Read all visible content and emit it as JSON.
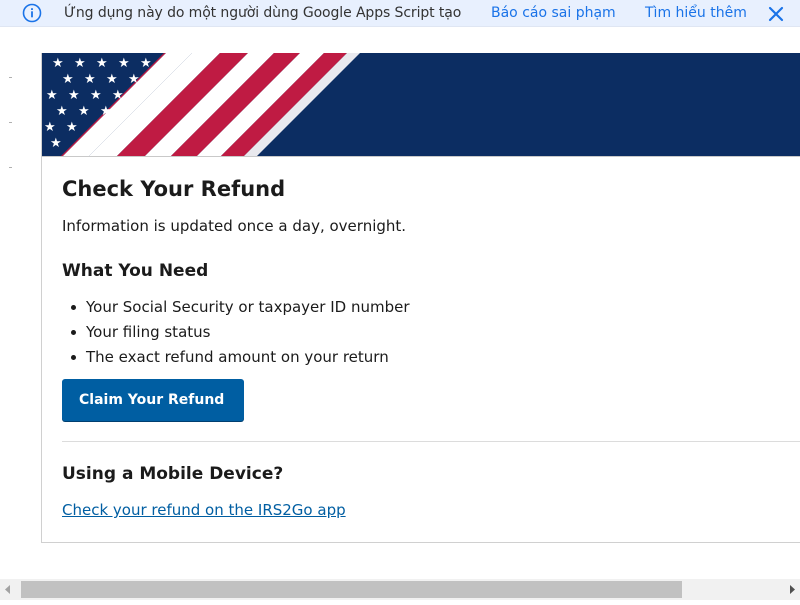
{
  "banner": {
    "icon": "info-icon",
    "message": "Ứng dụng này do một người dùng Google Apps Script tạo",
    "report_label": "Báo cáo sai phạm",
    "learn_more_label": "Tìm hiểu thêm",
    "close_icon": "close-icon",
    "background": "#e8f0fe",
    "link_color": "#1a73e8"
  },
  "card": {
    "title": "Check Your Refund",
    "subtitle": "Information is updated once a day, overnight.",
    "needs_heading": "What You Need",
    "needs": [
      "Your Social Security or taxpayer ID number",
      "Your filing status",
      "The exact refund amount on your return"
    ],
    "claim_button": "Claim Your Refund",
    "mobile_heading": "Using a Mobile Device?",
    "mobile_link": "Check your refund on the IRS2Go app",
    "accent": "#005ea2",
    "hero_navy": "#0c2d62",
    "hero_red": "#bf1b43"
  }
}
